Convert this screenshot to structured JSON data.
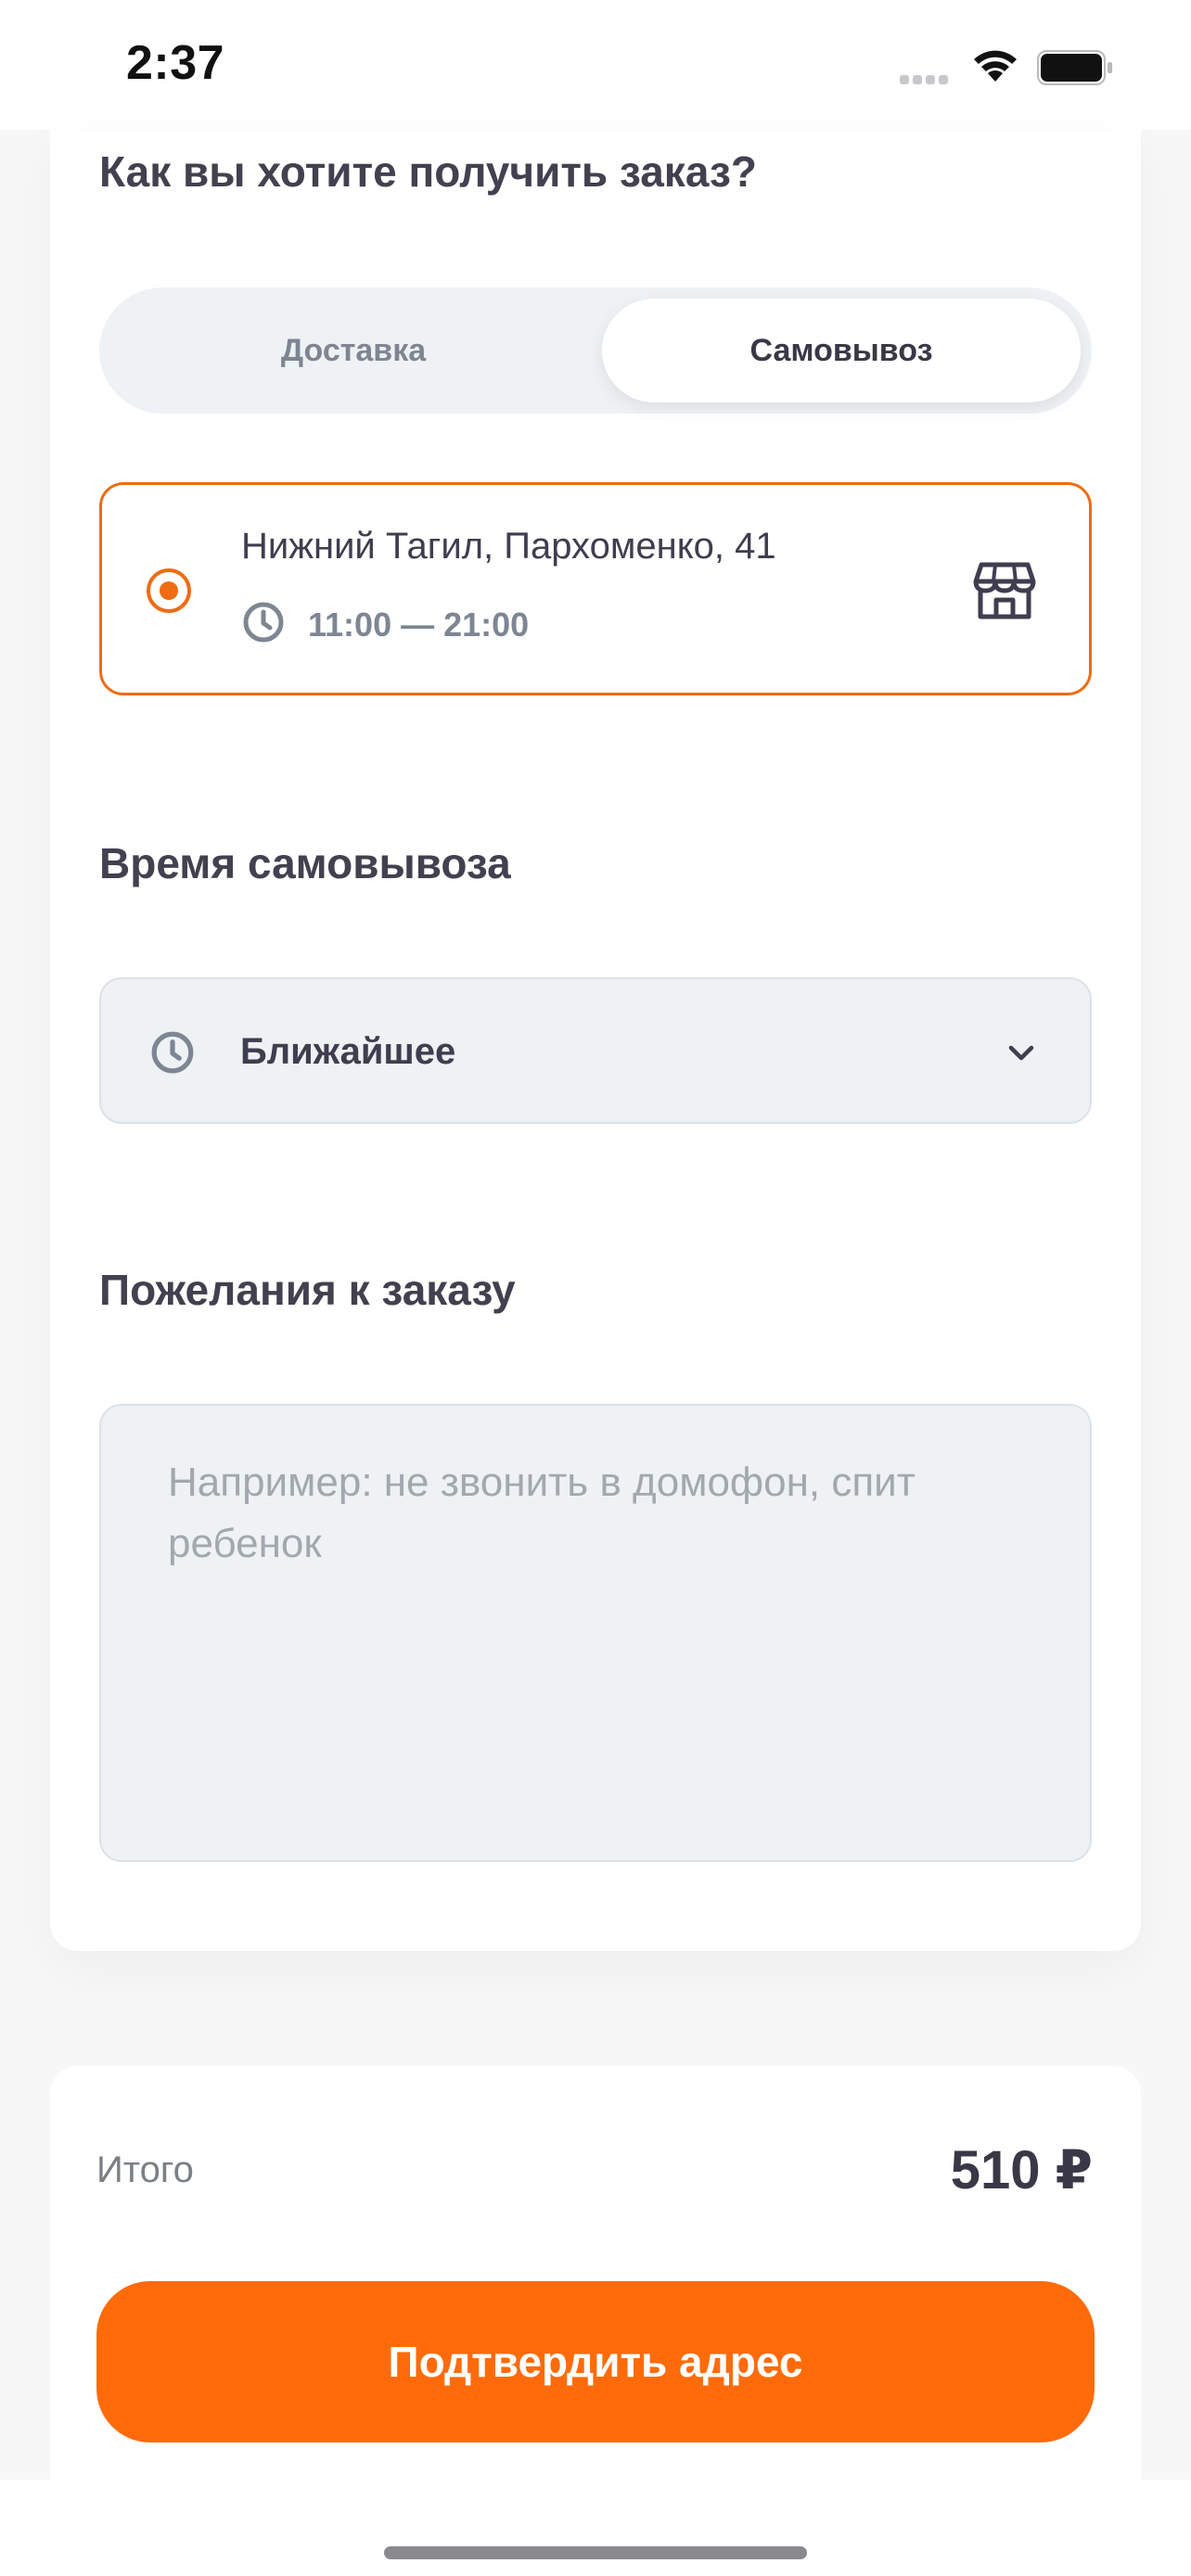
{
  "status_bar": {
    "time": "2:37"
  },
  "delivery_section": {
    "title": "Как вы хотите получить заказ?",
    "options": [
      {
        "label": "Доставка",
        "selected": false
      },
      {
        "label": "Самовывоз",
        "selected": true
      }
    ]
  },
  "pickup_point": {
    "address": "Нижний Тагил, Пархоменко, 41",
    "hours": "11:00 — 21:00",
    "selected": true,
    "icon": "store-icon"
  },
  "pickup_time": {
    "title": "Время самовывоза",
    "value": "Ближайшее"
  },
  "comment": {
    "title": "Пожелания к заказу",
    "placeholder": "Например: не звонить в домофон, спит ребенок",
    "value": ""
  },
  "summary": {
    "total_label": "Итого",
    "total_value": "510 ₽",
    "confirm_label": "Подтвердить адрес"
  },
  "colors": {
    "accent": "#ff6b0a",
    "accent_border": "#ef6c13",
    "field_bg": "#eff2f5",
    "text_primary": "#3f3d4f",
    "text_muted": "#7d8692"
  }
}
